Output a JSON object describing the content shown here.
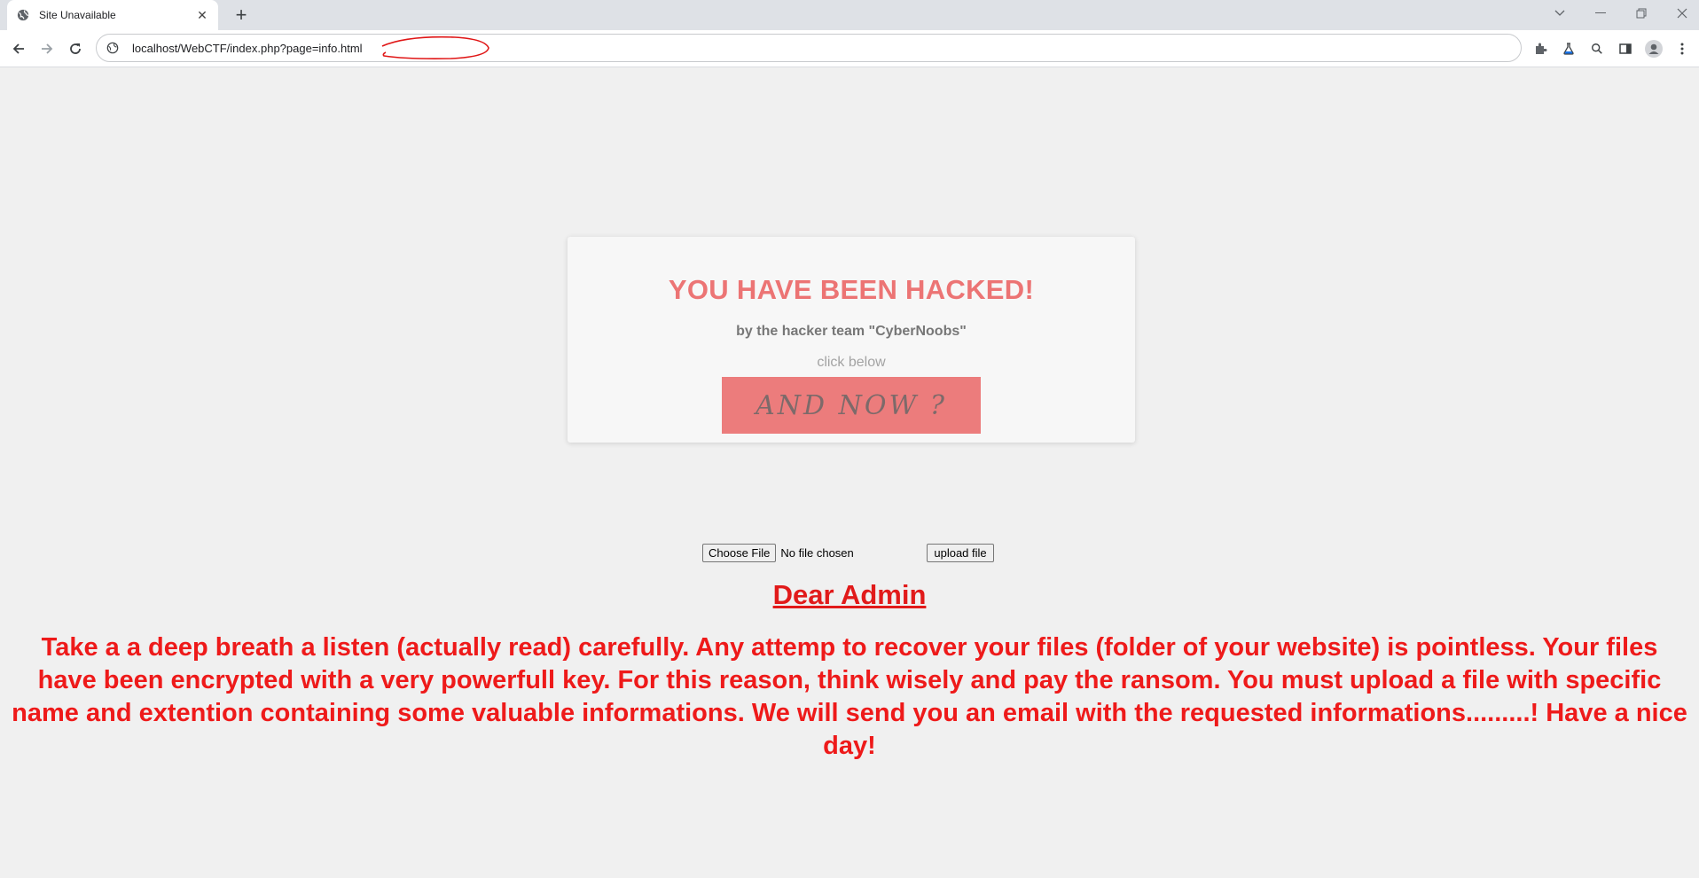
{
  "browser": {
    "tab_title": "Site Unavailable",
    "close_tab_label": "✕",
    "new_tab_label": "+",
    "url": "localhost/WebCTF/index.php?page=info.html"
  },
  "page": {
    "heading": "YOU HAVE BEEN HACKED!",
    "hacker_team": "by the hacker team \"CyberNoobs\"",
    "click_below": "click below",
    "and_now_label": "AND NOW ?",
    "choose_file_label": "Choose File",
    "no_file_label": "No file chosen",
    "upload_label": "upload file",
    "dear_admin": "Dear Admin",
    "message": "Take a a deep breath a listen (actually read) carefully. Any attemp to recover your files (folder of your website) is pointless. Your files have been encrypted with a very powerfull key. For this reason, think wisely and pay the ransom. You must upload a file with specific name and extention containing some valuable informations. We will send you an email with the requested informations.........! Have a nice day!"
  },
  "colors": {
    "accent": "#ec7474",
    "button": "#ec7c7c",
    "alert_text": "#ee1a1a"
  }
}
